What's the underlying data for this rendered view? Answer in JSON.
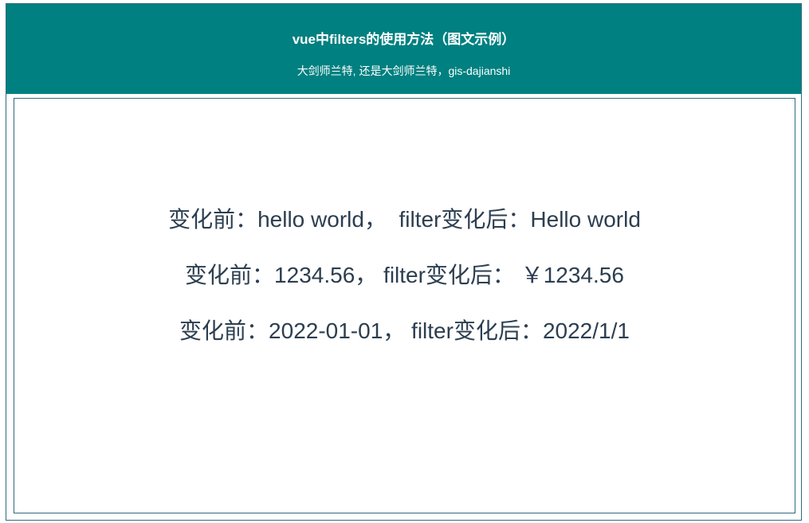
{
  "header": {
    "title": "vue中filters的使用方法（图文示例）",
    "subtitle": "大剑师兰特, 还是大剑师兰特，gis-dajianshi"
  },
  "rows": [
    "变化前：hello world，  filter变化后：Hello world",
    "变化前：1234.56， filter变化后： ￥1234.56",
    "变化前：2022-01-01， filter变化后：2022/1/1"
  ],
  "colors": {
    "header_bg": "#008080",
    "header_text": "#ffffff",
    "border": "#2e6b7b",
    "body_text": "#2c3e50"
  }
}
